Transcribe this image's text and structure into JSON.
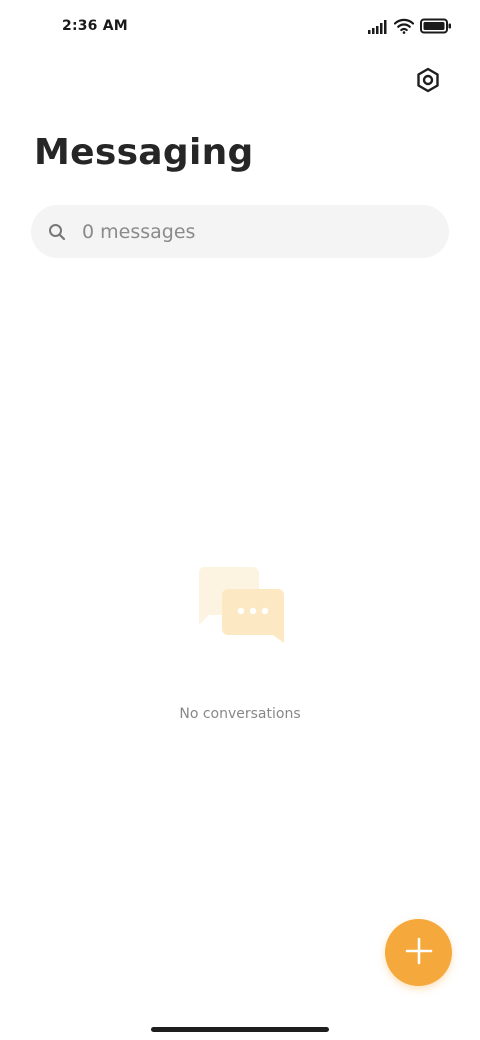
{
  "status_bar": {
    "time": "2:36 AM",
    "icons": [
      "signal-icon",
      "wifi-icon",
      "battery-icon"
    ]
  },
  "header": {
    "settings_icon": "settings-icon",
    "title": "Messaging"
  },
  "search": {
    "icon": "search-icon",
    "placeholder": "0 messages"
  },
  "empty_state": {
    "icon": "chat-bubbles-icon",
    "text": "No conversations"
  },
  "fab": {
    "icon": "plus-icon",
    "color": "#f5a83b"
  },
  "colors": {
    "accent": "#f5a83b",
    "illustration_light": "#fdf3e1",
    "illustration_main": "#fde8c4",
    "search_bg": "#f4f4f4",
    "title": "#262626",
    "muted_text": "#888888"
  }
}
